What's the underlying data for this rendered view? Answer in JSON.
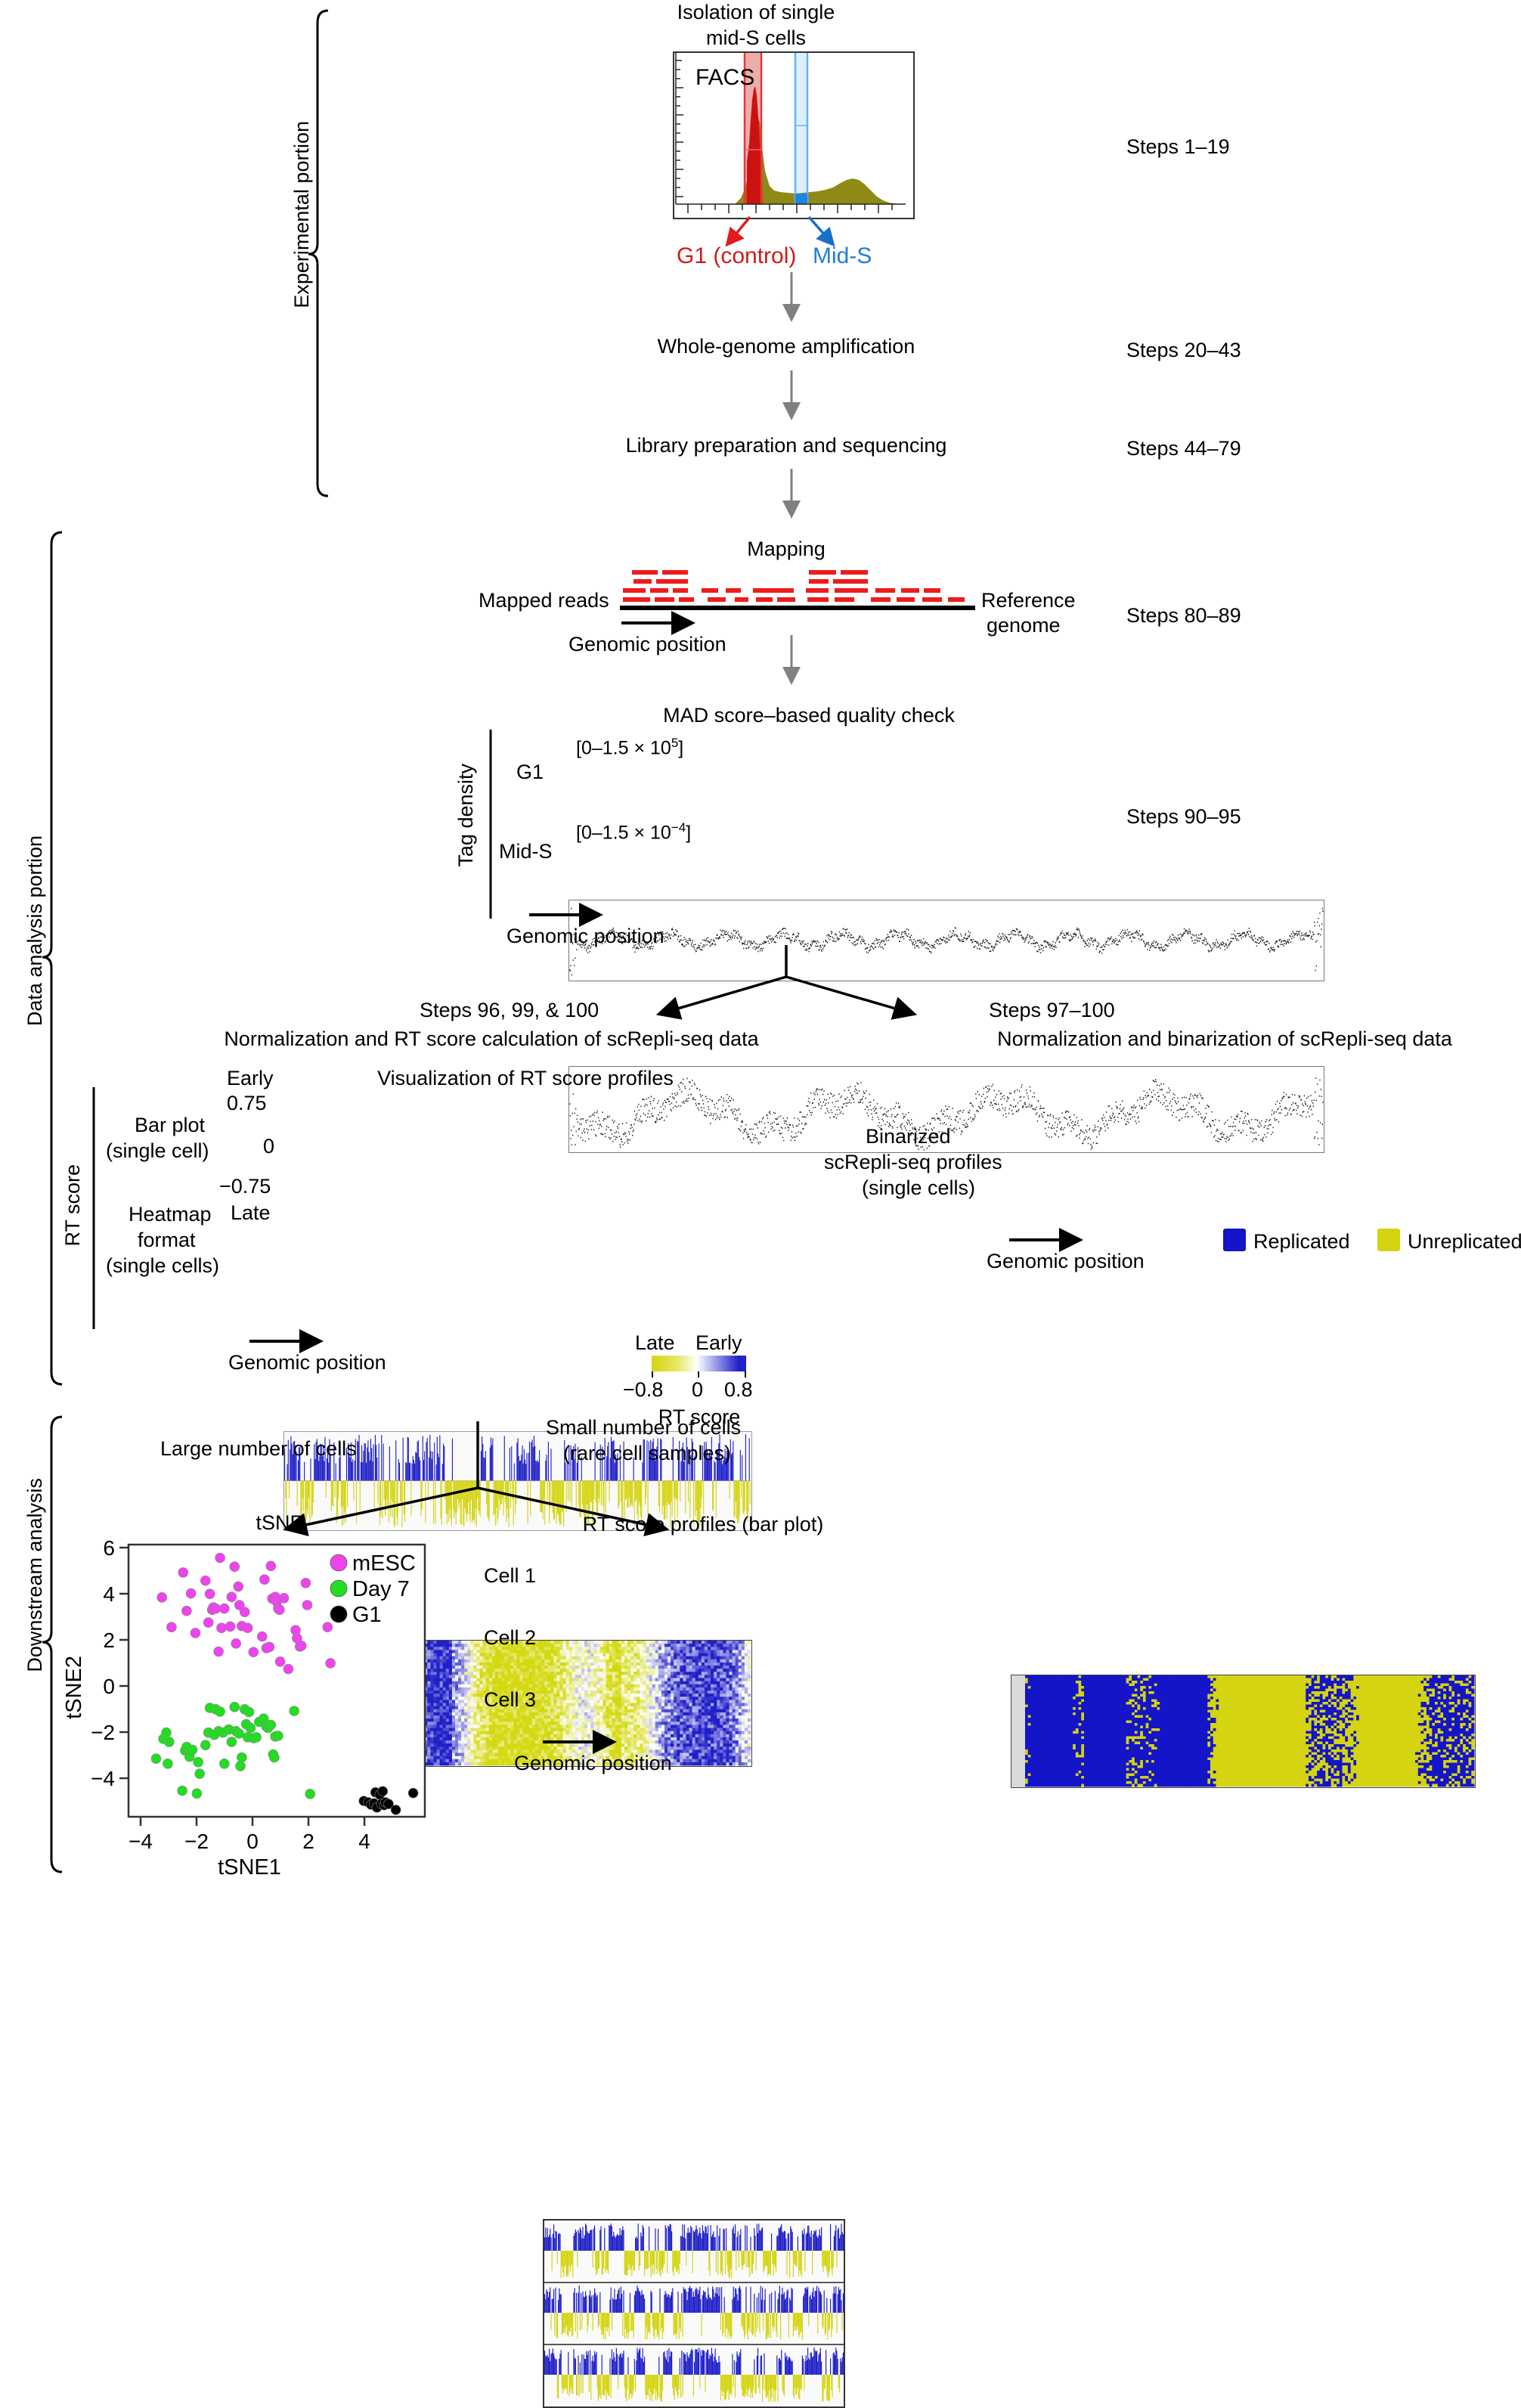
{
  "brackets": {
    "experimental": "Experimental portion",
    "data_analysis": "Data analysis portion",
    "downstream": "Downstream analysis",
    "rt_score": "RT score",
    "tag_density": "Tag density"
  },
  "steps": {
    "s1": "Steps 1–19",
    "s2": "Steps 20–43",
    "s3": "Steps 44–79",
    "s4": "Steps 80–89",
    "s5": "Steps 90–95",
    "s_left": "Steps 96, 99, & 100",
    "s_right": "Steps 97–100"
  },
  "facs": {
    "title_line1": "Isolation of single",
    "title_line2": "mid-S cells",
    "plot_label": "FACS",
    "gate_g1": "G1 (control)",
    "gate_mids": "Mid-S",
    "color_g1": "#d11a1a",
    "color_mids": "#1f7fd4",
    "hist_fill": "#8f8a16"
  },
  "flow": {
    "wga": "Whole-genome amplification",
    "library": "Library preparation and sequencing",
    "mapping": "Mapping",
    "mapped_reads": "Mapped reads",
    "reference_genome_l1": "Reference",
    "reference_genome_l2": "genome",
    "genomic_position": "Genomic position",
    "read_color": "#ee1c1c"
  },
  "mad": {
    "title": "MAD score–based quality check",
    "row1_label": "G1",
    "row2_label": "Mid-S",
    "row1_range_pre": "[0–1.5 × 10",
    "row1_range_exp": "5",
    "row1_range_post": "]",
    "row2_range_pre": "[0–1.5 × 10",
    "row2_range_exp": "−4",
    "row2_range_post": "]",
    "genomic_position": "Genomic position"
  },
  "left_branch": {
    "heading": "Normalization and RT score calculation of scRepli-seq data",
    "viz_title": "Visualization of RT score profiles",
    "barplot_label_l1": "Bar plot",
    "barplot_label_l2": "(single cell)",
    "heatmap_label_l1": "Heatmap",
    "heatmap_label_l2": "format",
    "heatmap_label_l3": "(single cells)",
    "axis_early": "Early",
    "axis_late": "Late",
    "tick_top": "0.75",
    "tick_mid": "0",
    "tick_bot": "−0.75",
    "genomic_position": "Genomic position",
    "scale_late": "Late",
    "scale_early": "Early",
    "scale_min": "−0.8",
    "scale_mid": "0",
    "scale_max": "0.8",
    "scale_title": "RT score",
    "color_early": "#2020c8",
    "color_late": "#d4d411"
  },
  "right_branch": {
    "heading": "Normalization and binarization of scRepli-seq data",
    "label_l1": "Binarized",
    "label_l2": "scRepli-seq profiles",
    "label_l3": "(single cells)",
    "genomic_position": "Genomic position",
    "legend_replicated": "Replicated",
    "legend_unreplicated": "Unreplicated",
    "color_replicated": "#1414c8",
    "color_unreplicated": "#d4d411"
  },
  "downstream": {
    "branch_left": "Large number of cells",
    "branch_right_l1": "Small number of cells",
    "branch_right_l2": "(rare cell samples)",
    "tsne_title": "tSNE",
    "profiles_title": "RT score profiles (bar plot)",
    "cell_labels": [
      "Cell 1",
      "Cell 2",
      "Cell 3"
    ],
    "genomic_position": "Genomic position"
  },
  "chart_data": [
    {
      "type": "scatter",
      "title": "tSNE",
      "xlabel": "tSNE1",
      "ylabel": "tSNE2",
      "xlim": [
        -4.6,
        5.6
      ],
      "ylim": [
        -5.4,
        6.3
      ],
      "xticks": [
        -4,
        -2,
        0,
        2,
        4
      ],
      "yticks": [
        -4,
        -2,
        0,
        2,
        4,
        6
      ],
      "grid": false,
      "legend_position": "top-right",
      "series": [
        {
          "name": "mESC",
          "color": "#ee44ee",
          "points": [
            [
              -3.45,
              4.03
            ],
            [
              -3.12,
              2.75
            ],
            [
              -2.72,
              5.1
            ],
            [
              -2.6,
              3.45
            ],
            [
              -2.45,
              4.2
            ],
            [
              -2.3,
              2.5
            ],
            [
              -1.95,
              4.75
            ],
            [
              -1.85,
              2.95
            ],
            [
              -1.8,
              4.18
            ],
            [
              -1.72,
              3.5
            ],
            [
              -1.68,
              3.6
            ],
            [
              -1.6,
              3.55
            ],
            [
              -1.5,
              1.7
            ],
            [
              -1.45,
              5.73
            ],
            [
              -1.4,
              2.72
            ],
            [
              -1.3,
              3.55
            ],
            [
              -1.1,
              2.78
            ],
            [
              -1.05,
              4.05
            ],
            [
              -0.95,
              5.35
            ],
            [
              -0.9,
              2.05
            ],
            [
              -0.82,
              4.5
            ],
            [
              -0.78,
              3.7
            ],
            [
              -0.7,
              2.8
            ],
            [
              -0.6,
              3.4
            ],
            [
              -0.5,
              2.72
            ],
            [
              -0.3,
              1.68
            ],
            [
              0.0,
              2.35
            ],
            [
              0.08,
              4.8
            ],
            [
              0.15,
              1.85
            ],
            [
              0.25,
              1.9
            ],
            [
              0.3,
              5.38
            ],
            [
              0.35,
              3.98
            ],
            [
              0.45,
              4.05
            ],
            [
              0.5,
              3.85
            ],
            [
              0.55,
              3.55
            ],
            [
              0.6,
              3.5
            ],
            [
              0.62,
              1.27
            ],
            [
              0.75,
              4.0
            ],
            [
              0.9,
              0.95
            ],
            [
              1.15,
              2.62
            ],
            [
              1.2,
              2.28
            ],
            [
              1.3,
              1.92
            ],
            [
              1.35,
              1.95
            ],
            [
              1.5,
              4.65
            ],
            [
              1.55,
              3.7
            ],
            [
              2.25,
              2.75
            ],
            [
              2.35,
              1.2
            ]
          ]
        },
        {
          "name": "Day 7",
          "color": "#22dd22",
          "points": [
            [
              -3.65,
              -2.9
            ],
            [
              -3.3,
              -1.78
            ],
            [
              -3.25,
              -3.12
            ],
            [
              -3.2,
              -2.18
            ],
            [
              -3.4,
              -2.05
            ],
            [
              -2.75,
              -4.28
            ],
            [
              -2.65,
              -2.55
            ],
            [
              -2.6,
              -2.4
            ],
            [
              -2.5,
              -2.82
            ],
            [
              -2.4,
              -2.52
            ],
            [
              -2.25,
              -4.4
            ],
            [
              -2.2,
              -3.05
            ],
            [
              -2.15,
              -3.55
            ],
            [
              -1.95,
              -2.32
            ],
            [
              -1.85,
              -1.78
            ],
            [
              -1.8,
              -0.72
            ],
            [
              -1.65,
              -1.88
            ],
            [
              -1.6,
              -0.78
            ],
            [
              -1.5,
              -1.72
            ],
            [
              -1.45,
              -0.88
            ],
            [
              -1.35,
              -1.78
            ],
            [
              -1.3,
              -3.12
            ],
            [
              -1.15,
              -1.65
            ],
            [
              -1.05,
              -2.18
            ],
            [
              -0.95,
              -0.68
            ],
            [
              -0.9,
              -1.72
            ],
            [
              -0.8,
              -1.82
            ],
            [
              -0.75,
              -3.22
            ],
            [
              -0.7,
              -2.85
            ],
            [
              -0.6,
              -0.78
            ],
            [
              -0.55,
              -1.42
            ],
            [
              -0.5,
              -1.98
            ],
            [
              -0.45,
              -0.9
            ],
            [
              -0.4,
              -1.58
            ],
            [
              -0.3,
              -2.02
            ],
            [
              -0.2,
              -1.98
            ],
            [
              -0.1,
              -1.32
            ],
            [
              0.05,
              -1.18
            ],
            [
              0.15,
              -1.52
            ],
            [
              0.2,
              -1.58
            ],
            [
              0.3,
              -1.45
            ],
            [
              0.38,
              -2.72
            ],
            [
              0.42,
              -2.85
            ],
            [
              0.45,
              -1.95
            ],
            [
              0.55,
              -1.92
            ],
            [
              1.1,
              -0.85
            ],
            [
              1.65,
              -4.42
            ]
          ]
        },
        {
          "name": "G1",
          "color": "#000000",
          "points": [
            [
              3.5,
              -4.72
            ],
            [
              3.65,
              -4.78
            ],
            [
              3.75,
              -4.88
            ],
            [
              3.85,
              -4.82
            ],
            [
              3.9,
              -4.35
            ],
            [
              3.95,
              -5.0
            ],
            [
              4.05,
              -4.45
            ],
            [
              4.1,
              -4.85
            ],
            [
              4.15,
              -4.3
            ],
            [
              4.2,
              -4.9
            ],
            [
              4.25,
              -4.78
            ],
            [
              4.35,
              -4.85
            ],
            [
              4.6,
              -5.1
            ],
            [
              5.2,
              -4.38
            ]
          ]
        }
      ]
    },
    {
      "type": "bar",
      "title": "Visualization of RT score profiles (single cell)",
      "ylabel": "RT score",
      "ylim": [
        -0.75,
        0.75
      ],
      "yticks": [
        -0.75,
        0,
        0.75
      ],
      "xlabel": "Genomic position",
      "positive_color": "#2020c8",
      "negative_color": "#d4d411",
      "n_bins": 300
    },
    {
      "type": "heatmap",
      "title": "Heatmap format (single cells)",
      "xlabel": "Genomic position",
      "colorbar": {
        "min": -0.8,
        "mid": 0,
        "max": 0.8,
        "low_label": "Late",
        "high_label": "Early",
        "title": "RT score"
      },
      "low_color": "#d4d411",
      "high_color": "#2020c8"
    },
    {
      "type": "heatmap",
      "title": "Binarized scRepli-seq profiles (single cells)",
      "xlabel": "Genomic position",
      "categories": [
        "Replicated",
        "Unreplicated"
      ],
      "colors": [
        "#1414c8",
        "#d4d411"
      ]
    }
  ]
}
